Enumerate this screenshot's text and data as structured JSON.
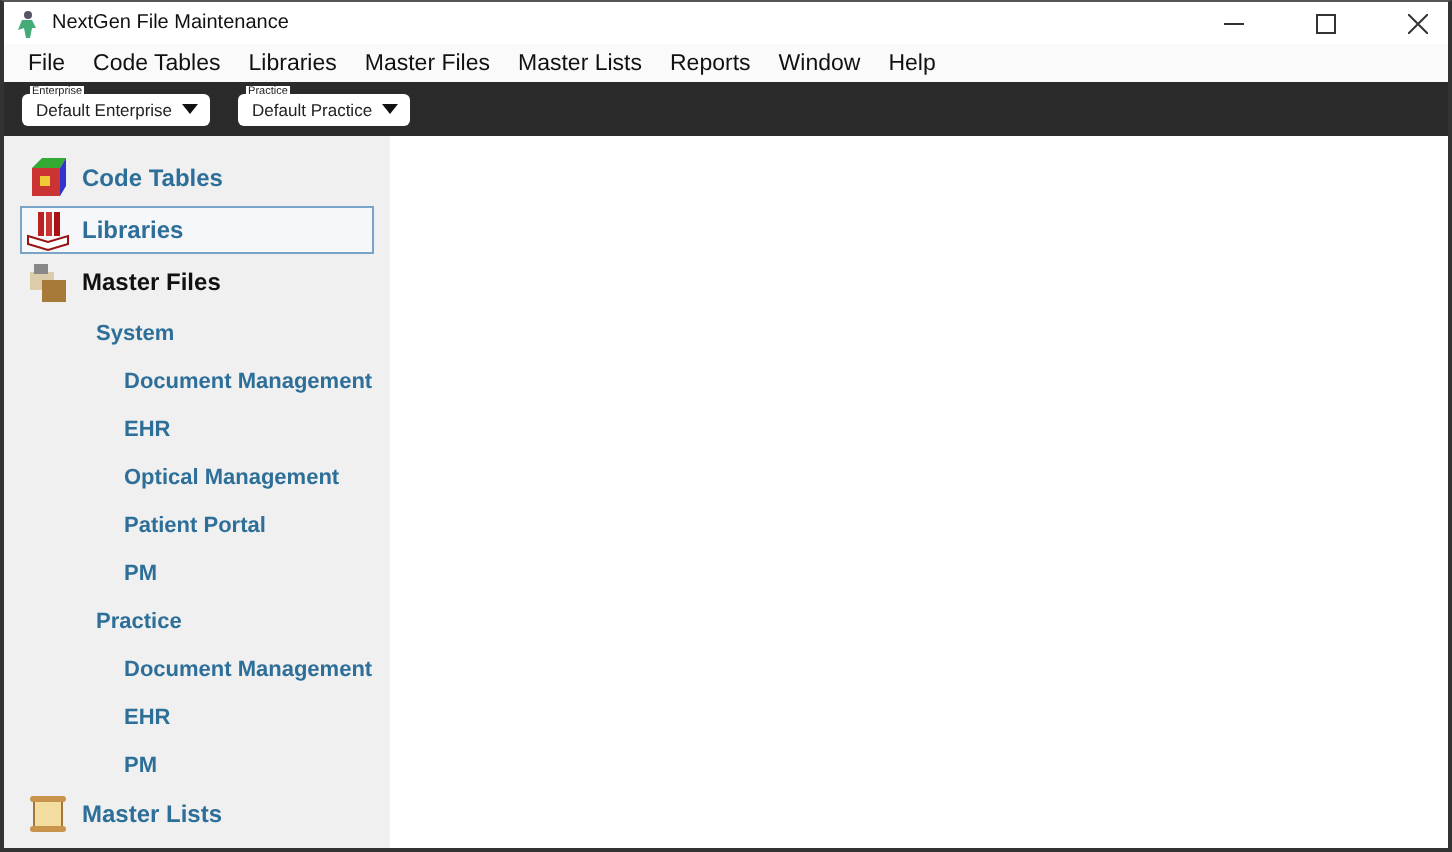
{
  "window": {
    "title": "NextGen File Maintenance"
  },
  "menu": [
    "File",
    "Code Tables",
    "Libraries",
    "Master Files",
    "Master Lists",
    "Reports",
    "Window",
    "Help"
  ],
  "toolbar": [
    {
      "label": "Enterprise",
      "value": "Default Enterprise"
    },
    {
      "label": "Practice",
      "value": "Default Practice"
    }
  ],
  "sidebar": {
    "items": [
      {
        "label": "Code Tables",
        "kind": "cube",
        "selected": false,
        "expanded": false
      },
      {
        "label": "Libraries",
        "kind": "books",
        "selected": true,
        "expanded": false
      },
      {
        "label": "Master Files",
        "kind": "files",
        "selected": false,
        "expanded": true,
        "children": [
          {
            "label": "System",
            "children": [
              {
                "label": "Document Management"
              },
              {
                "label": "EHR"
              },
              {
                "label": "Optical Management"
              },
              {
                "label": "Patient Portal"
              },
              {
                "label": "PM"
              }
            ]
          },
          {
            "label": "Practice",
            "children": [
              {
                "label": "Document Management"
              },
              {
                "label": "EHR"
              },
              {
                "label": "PM"
              }
            ]
          }
        ]
      },
      {
        "label": "Master Lists",
        "kind": "scroll",
        "selected": false,
        "expanded": false
      }
    ]
  }
}
